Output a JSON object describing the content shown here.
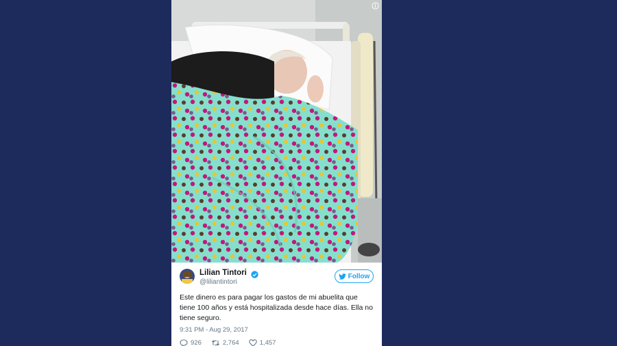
{
  "tweet": {
    "display_name": "Lilian Tintori",
    "handle": "@liliantintori",
    "follow_label": "Follow",
    "text": "Este dinero es para pagar los gastos de mi abuelita que tiene 100 años y está hospitalizada desde hace días. Ella no tiene seguro.",
    "timestamp": "9:31 PM - Aug 29, 2017",
    "replies": "926",
    "retweets": "2,764",
    "likes": "1,457"
  },
  "icons": {
    "info": "info-icon",
    "verified": "verified-badge-icon",
    "twitter": "twitter-bird-icon",
    "reply": "reply-icon",
    "retweet": "retweet-icon",
    "like": "heart-icon"
  },
  "colors": {
    "background": "#1d2a5c",
    "twitter_blue": "#1da1f2",
    "blanket": "#7fdcc8"
  }
}
